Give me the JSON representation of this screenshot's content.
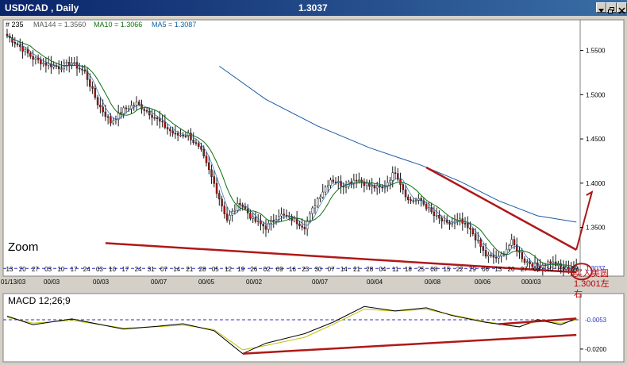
{
  "window": {
    "title": "USD/CAD , Daily",
    "price": "1.3037",
    "header_count": "# 235",
    "ma_labels": [
      {
        "text": "MA144 = 1.3560",
        "color": "#5a5a5a"
      },
      {
        "text": "MA10 = 1.3066",
        "color": "#107010"
      },
      {
        "text": "MA5 = 1.3087",
        "color": "#1060a0"
      }
    ],
    "zoom_label": "Zoom",
    "annotation": [
      "买入美圆",
      "1.3001左",
      "右"
    ],
    "macd_title": "MACD 12;26;9"
  },
  "colors": {
    "background": "#ffffff",
    "candle": "#1a1a1a",
    "ma_short": "#107010",
    "ma_long": "#1c5aa6",
    "trendline": "#b01818",
    "dashed": "#3030c0",
    "macd": "#000000",
    "signal": "#c0c000"
  },
  "chart_data": [
    {
      "type": "candlestick",
      "title": "USD/CAD , Daily",
      "ylim": [
        1.2949,
        1.5846
      ],
      "yticks": [
        1.35,
        1.4,
        1.45,
        1.5,
        1.55
      ],
      "ytick_labels": [
        "1.3500",
        "1.4000",
        "1.4500",
        "1.5000",
        "1.5500"
      ],
      "current_price": 1.3037,
      "current_label": "1.3037",
      "x_day_labels": [
        "13",
        "20",
        "27",
        "03",
        "10",
        "17",
        "24",
        "03",
        "10",
        "17",
        "24",
        "31",
        "07",
        "14",
        "21",
        "28",
        "05",
        "12",
        "19",
        "26",
        "02",
        "09",
        "16",
        "23",
        "30",
        "07",
        "14",
        "21",
        "28",
        "04",
        "11",
        "18",
        "25",
        "08",
        "15",
        "22",
        "29",
        "06",
        "13",
        "20",
        "27",
        "03",
        "10",
        "17",
        "24"
      ],
      "x_month_labels": [
        "01/13/03",
        "00/03",
        "00/03",
        "00/07",
        "00/05",
        "00/02",
        "00/07",
        "00/04",
        "00/08",
        "00/06",
        "000/03"
      ],
      "close_path": [
        [
          0,
          1.5665
        ],
        [
          5,
          1.5542
        ],
        [
          10,
          1.5412
        ],
        [
          15,
          1.5348
        ],
        [
          20,
          1.5311
        ],
        [
          25,
          1.5359
        ],
        [
          30,
          1.5254
        ],
        [
          35,
          1.4901
        ],
        [
          40,
          1.4688
        ],
        [
          45,
          1.4828
        ],
        [
          50,
          1.4901
        ],
        [
          55,
          1.4795
        ],
        [
          60,
          1.4664
        ],
        [
          65,
          1.4543
        ],
        [
          70,
          1.4551
        ],
        [
          75,
          1.4354
        ],
        [
          80,
          1.3993
        ],
        [
          85,
          1.3587
        ],
        [
          90,
          1.3785
        ],
        [
          95,
          1.3586
        ],
        [
          100,
          1.35
        ],
        [
          105,
          1.3649
        ],
        [
          110,
          1.3592
        ],
        [
          115,
          1.3511
        ],
        [
          120,
          1.3825
        ],
        [
          125,
          1.4044
        ],
        [
          130,
          1.3976
        ],
        [
          135,
          1.4055
        ],
        [
          140,
          1.3966
        ],
        [
          145,
          1.3937
        ],
        [
          150,
          1.4134
        ],
        [
          155,
          1.3807
        ],
        [
          160,
          1.38
        ],
        [
          165,
          1.3633
        ],
        [
          170,
          1.3533
        ],
        [
          175,
          1.3572
        ],
        [
          180,
          1.3431
        ],
        [
          185,
          1.3181
        ],
        [
          190,
          1.3151
        ],
        [
          195,
          1.3334
        ],
        [
          200,
          1.3123
        ],
        [
          205,
          1.3061
        ],
        [
          210,
          1.3112
        ],
        [
          215,
          1.3032
        ],
        [
          220,
          1.3037
        ]
      ],
      "ma_long_path": [
        [
          82,
          1.5322
        ],
        [
          100,
          1.4946
        ],
        [
          120,
          1.4646
        ],
        [
          140,
          1.44
        ],
        [
          160,
          1.4203
        ],
        [
          175,
          1.402
        ],
        [
          190,
          1.38
        ],
        [
          205,
          1.3631
        ],
        [
          220,
          1.356
        ]
      ],
      "support_line": [
        [
          38,
          1.3322
        ],
        [
          220,
          1.2993
        ]
      ],
      "resistance_line": [
        [
          162,
          1.4178
        ],
        [
          220,
          1.3246
        ]
      ],
      "target_arrow": [
        [
          220,
          1.3249
        ],
        [
          226,
          1.39
        ]
      ],
      "target_ellipse_center": [
        222,
        1.3001
      ]
    },
    {
      "type": "line",
      "title": "MACD 12;26;9",
      "ylim": [
        -0.0264,
        0.0078
      ],
      "yticks": [
        -0.02
      ],
      "ytick_labels": [
        "-0.0200"
      ],
      "current_level": -0.0053,
      "current_label": "-0.0053",
      "series": [
        {
          "name": "MACD",
          "points": [
            [
              0,
              -0.0035
            ],
            [
              10,
              -0.0078
            ],
            [
              25,
              -0.0049
            ],
            [
              45,
              -0.01
            ],
            [
              58,
              -0.0086
            ],
            [
              68,
              -0.0073
            ],
            [
              80,
              -0.0108
            ],
            [
              91,
              -0.0223
            ],
            [
              100,
              -0.0171
            ],
            [
              115,
              -0.0123
            ],
            [
              126,
              -0.0065
            ],
            [
              138,
              0.0013
            ],
            [
              150,
              -0.0009
            ],
            [
              162,
              0.0007
            ],
            [
              172,
              -0.0032
            ],
            [
              185,
              -0.0066
            ],
            [
              198,
              -0.0089
            ],
            [
              205,
              -0.0052
            ],
            [
              214,
              -0.0078
            ],
            [
              220,
              -0.0047
            ]
          ]
        },
        {
          "name": "Signal",
          "points": [
            [
              0,
              -0.0041
            ],
            [
              10,
              -0.007
            ],
            [
              25,
              -0.0056
            ],
            [
              45,
              -0.0095
            ],
            [
              58,
              -0.0088
            ],
            [
              68,
              -0.008
            ],
            [
              80,
              -0.0102
            ],
            [
              91,
              -0.0204
            ],
            [
              100,
              -0.0182
            ],
            [
              115,
              -0.0141
            ],
            [
              126,
              -0.0076
            ],
            [
              138,
              0.0
            ],
            [
              150,
              -0.001
            ],
            [
              162,
              0.0
            ],
            [
              172,
              -0.0029
            ],
            [
              185,
              -0.0063
            ],
            [
              198,
              -0.0087
            ],
            [
              205,
              -0.006
            ],
            [
              214,
              -0.007
            ],
            [
              220,
              -0.0054
            ]
          ]
        }
      ],
      "trendline": [
        [
          91,
          -0.0223
        ],
        [
          220,
          -0.0129
        ]
      ],
      "trendline_short": [
        [
          190,
          -0.0075
        ],
        [
          220,
          -0.0047
        ]
      ]
    }
  ]
}
